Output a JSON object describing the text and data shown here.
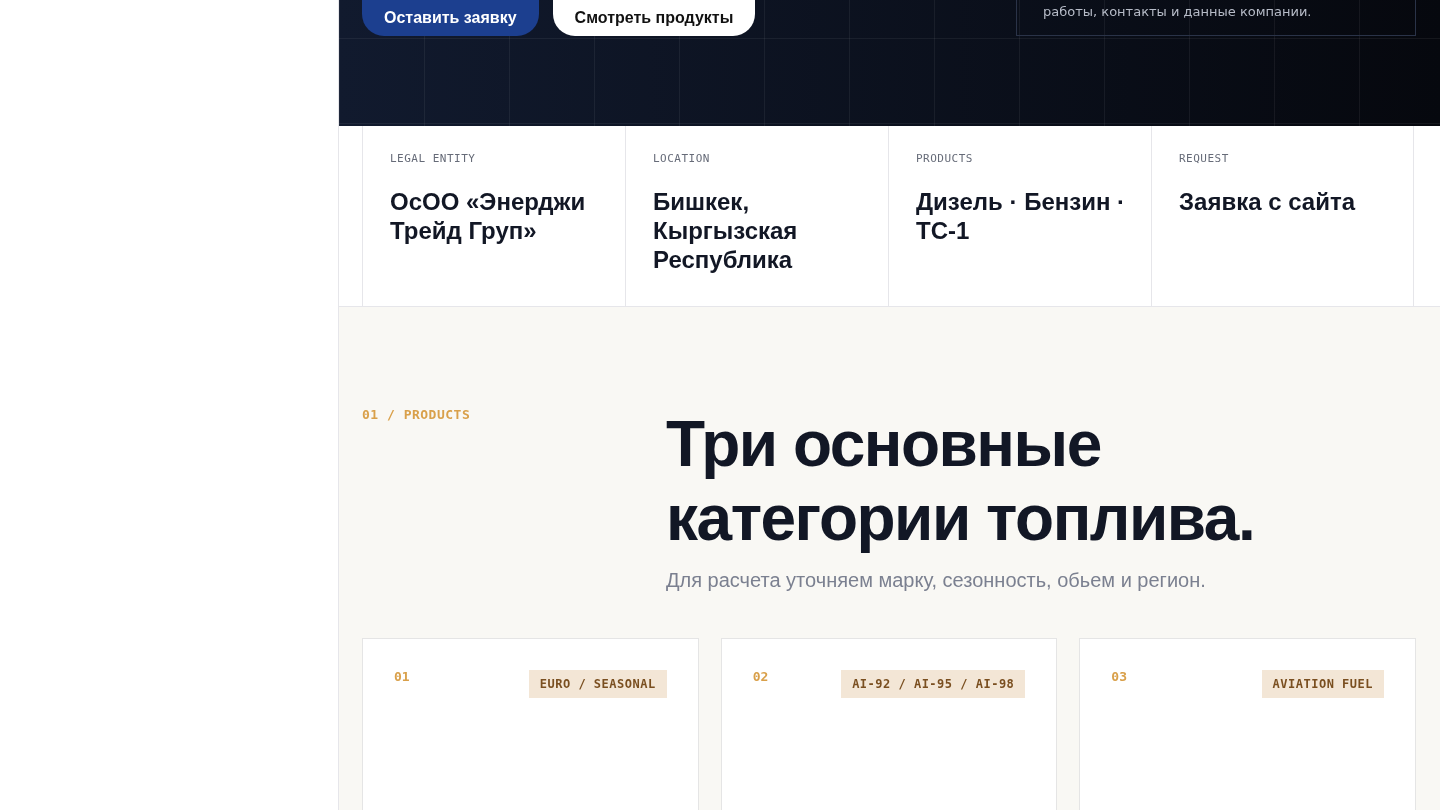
{
  "hero": {
    "buttons": [
      {
        "label": "Оставить заявку",
        "kind": "primary"
      },
      {
        "label": "Смотреть продукты",
        "kind": "secondary"
      }
    ],
    "note": "работы, контакты и данные компании."
  },
  "facts": [
    {
      "label": "LEGAL ENTITY",
      "value": "ОсОО «Энерджи Трейд Груп»"
    },
    {
      "label": "LOCATION",
      "value": "Бишкек, Кыргызская Республика"
    },
    {
      "label": "PRODUCTS",
      "value": "Дизель · Бензин · ТС-1"
    },
    {
      "label": "REQUEST",
      "value": "Заявка с сайта"
    }
  ],
  "section": {
    "eyebrow": "01 / PRODUCTS",
    "title": "Три основные категории топлива.",
    "subtitle": "Для расчета уточняем марку, сезонность, обьем и регион.",
    "cards": [
      {
        "number": "01",
        "tag": "EURO / SEASONAL"
      },
      {
        "number": "02",
        "tag": "AI-92 / AI-95 / AI-98"
      },
      {
        "number": "03",
        "tag": "AVIATION FUEL"
      }
    ]
  }
}
